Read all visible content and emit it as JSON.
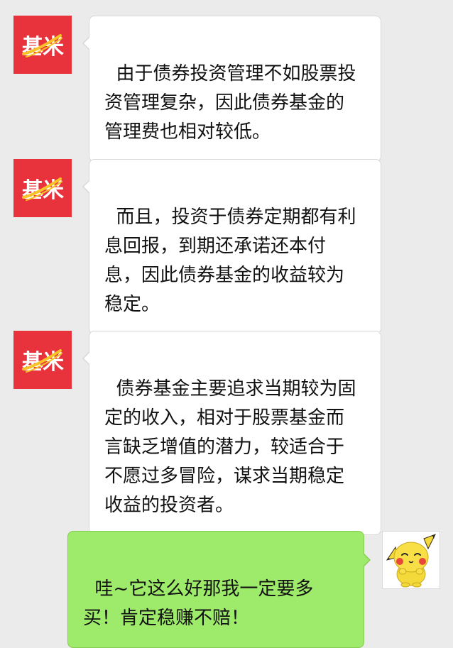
{
  "brand": {
    "logo_text": "基米",
    "color": "#e8323c",
    "swoosh_color": "#f7c325"
  },
  "messages": [
    {
      "from": "brand",
      "text": "由于债券投资管理不如股票投\n资管理复杂，因此债券基金的\n管理费也相对较低。"
    },
    {
      "from": "brand",
      "text": "而且，投资于债券定期都有利\n息回报，到期还承诺还本付\n息，因此债券基金的收益较为\n稳定。"
    },
    {
      "from": "brand",
      "text": "债券基金主要追求当期较为固\n定的收入，相对于股票基金而\n言缺乏增值的潜力，较适合于\n不愿过多冒险，谋求当期稳定\n收益的投资者。"
    },
    {
      "from": "user",
      "text": "哇~它这么好那我一定要多\n买！肯定稳赚不赔！"
    }
  ],
  "user_avatar": {
    "icon": "pikachu-avatar-icon"
  },
  "colors": {
    "background": "#ebebeb",
    "incoming_bubble": "#ffffff",
    "outgoing_bubble": "#9eea6a"
  }
}
